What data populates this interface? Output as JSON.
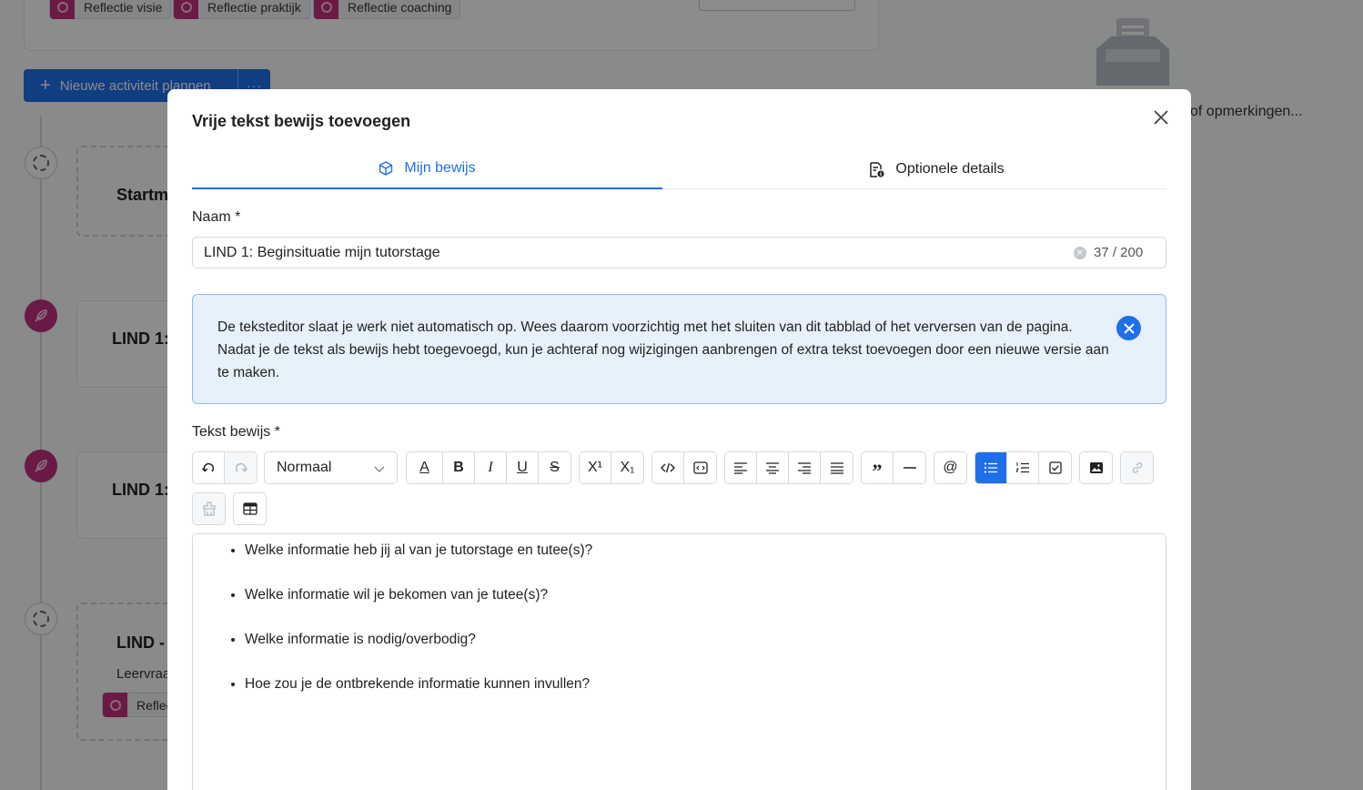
{
  "background": {
    "tags": [
      "Reflectie visie",
      "Reflectie praktijk",
      "Reflectie coaching"
    ],
    "plan_button": {
      "label": "Nieuwe activiteit plannen",
      "more": "···"
    },
    "timeline": [
      {
        "title": "Startm"
      },
      {
        "title": "LIND 1:"
      },
      {
        "title": "LIND 1:"
      },
      {
        "title": "LIND -",
        "subtitle": "Leervraa",
        "tag": "Reflec"
      }
    ],
    "right_text": "of opmerkingen..."
  },
  "modal": {
    "title": "Vrije tekst bewijs toevoegen",
    "tabs": [
      {
        "label": "Mijn bewijs",
        "icon": "cube-icon",
        "active": true
      },
      {
        "label": "Optionele details",
        "icon": "document-info-icon",
        "active": false
      }
    ],
    "name_field": {
      "label": "Naam *",
      "value": "LIND 1: Beginsituatie mijn tutorstage",
      "counter": "37 / 200"
    },
    "alert": {
      "text": "De teksteditor slaat je werk niet automatisch op. Wees daarom voorzichtig met het sluiten van dit tabblad of het verversen van de pagina. Nadat je de tekst als bewijs hebt toegevoegd, kun je achteraf nog wijzigingen aanbrengen of extra tekst toevoegen door een nieuwe versie aan te maken."
    },
    "editor": {
      "label": "Tekst bewijs *",
      "style_select": "Normaal",
      "bullets": [
        "Welke informatie heb jij al van je tutorstage en tutee(s)?",
        "Welke informatie wil je bekomen van je tutee(s)?",
        "Welke informatie is nodig/overbodig?",
        "Hoe zou je de ontbrekende informatie kunnen invullen?"
      ]
    },
    "colors": {
      "accent": "#1f6feb",
      "alert_bg": "#e6f1fc",
      "tag": "#c2307f"
    }
  }
}
